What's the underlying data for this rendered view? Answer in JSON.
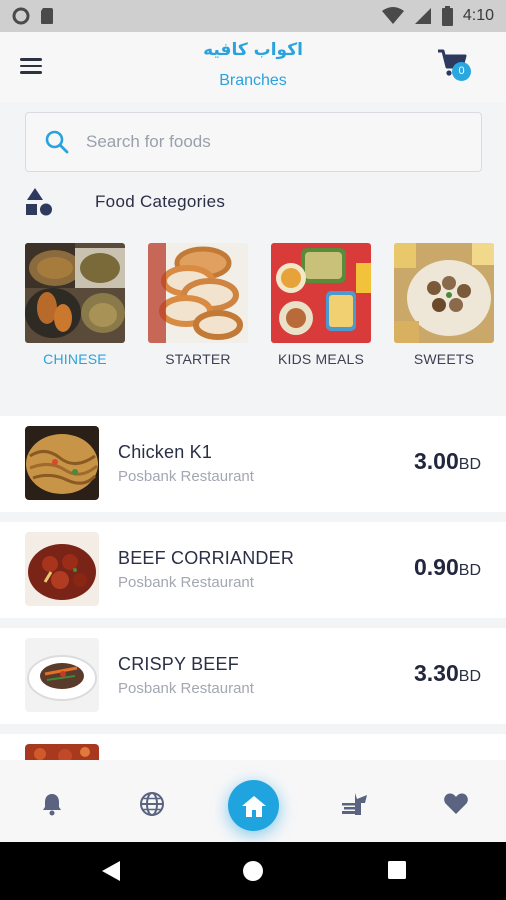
{
  "status_bar": {
    "time": "4:10"
  },
  "header": {
    "title": "اكواب كافيه",
    "subtitle": "Branches",
    "cart_count": "0"
  },
  "search": {
    "placeholder": "Search for foods"
  },
  "categories_section": {
    "title": "Food Categories",
    "items": [
      {
        "label": "CHINESE",
        "active": true
      },
      {
        "label": "STARTER",
        "active": false
      },
      {
        "label": "KIDS MEALS",
        "active": false
      },
      {
        "label": "SWEETS",
        "active": false
      }
    ]
  },
  "foods": [
    {
      "name": "Chicken K1",
      "restaurant": "Posbank Restaurant",
      "price": "3.00",
      "currency": "BD"
    },
    {
      "name": "BEEF CORRIANDER",
      "restaurant": "Posbank Restaurant",
      "price": "0.90",
      "currency": "BD"
    },
    {
      "name": "CRISPY BEEF",
      "restaurant": "Posbank Restaurant",
      "price": "3.30",
      "currency": "BD"
    }
  ],
  "bottom_nav": [
    "bell-icon",
    "globe-icon",
    "home-icon",
    "restaurant-icon",
    "heart-icon"
  ],
  "colors": {
    "accent": "#1fa4e0",
    "text": "#2b2f45",
    "muted": "#a3a7b2"
  }
}
